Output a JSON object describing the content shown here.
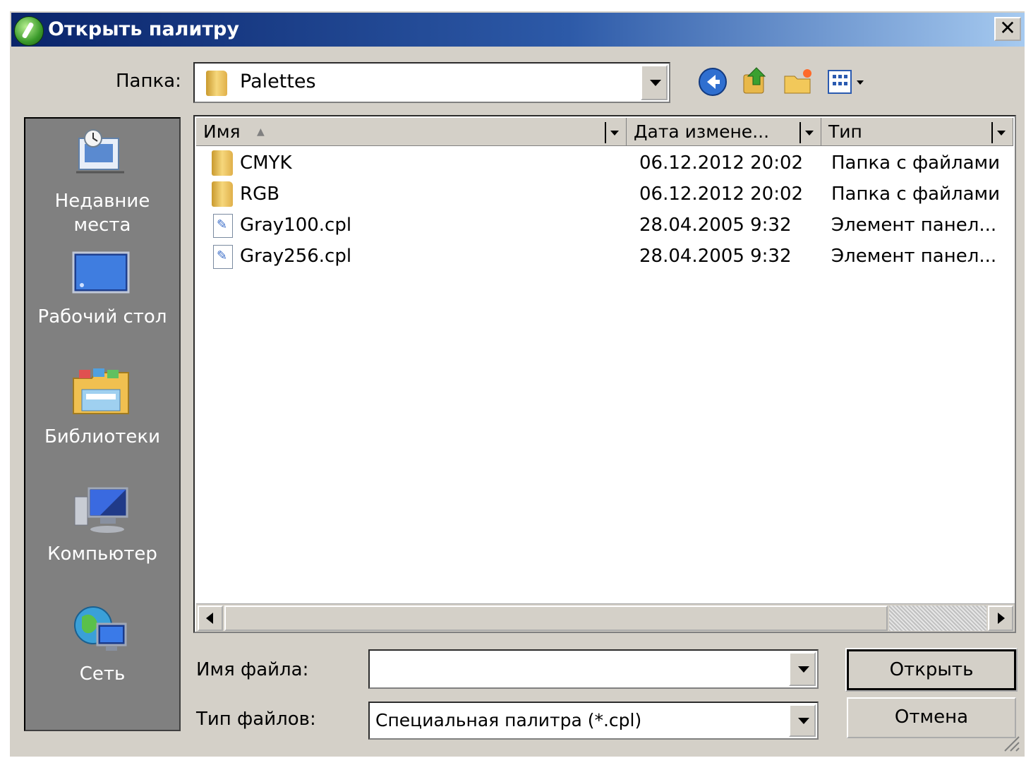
{
  "dialog": {
    "title": "Открыть палитру",
    "close_label": "✕"
  },
  "folder": {
    "label": "Папка:",
    "current": "Palettes"
  },
  "places": [
    {
      "label": "Недавние места",
      "icon": "recent-places-icon"
    },
    {
      "label": "Рабочий стол",
      "icon": "desktop-icon"
    },
    {
      "label": "Библиотеки",
      "icon": "libraries-icon"
    },
    {
      "label": "Компьютер",
      "icon": "computer-icon"
    },
    {
      "label": "Сеть",
      "icon": "network-icon"
    }
  ],
  "columns": {
    "name": "Имя",
    "date": "Дата измене...",
    "type": "Тип"
  },
  "files": [
    {
      "name": "CMYK",
      "date": "06.12.2012 20:02",
      "type": "Папка с файлами",
      "icon": "folder-icon"
    },
    {
      "name": "RGB",
      "date": "06.12.2012 20:02",
      "type": "Папка с файлами",
      "icon": "folder-icon"
    },
    {
      "name": "Gray100.cpl",
      "date": "28.04.2005 9:32",
      "type": "Элемент панел...",
      "icon": "cpl-file-icon"
    },
    {
      "name": "Gray256.cpl",
      "date": "28.04.2005 9:32",
      "type": "Элемент панел...",
      "icon": "cpl-file-icon"
    }
  ],
  "filename": {
    "label": "Имя файла:",
    "value": ""
  },
  "filetype": {
    "label": "Тип файлов:",
    "value": "Специальная палитра (*.cpl)"
  },
  "buttons": {
    "open": "Открыть",
    "cancel": "Отмена"
  },
  "colors": {
    "title_bar_start": "#0a246a",
    "title_bar_end": "#a6caf0",
    "dialog_bg": "#d4d0c8",
    "places_bg": "#808080"
  }
}
